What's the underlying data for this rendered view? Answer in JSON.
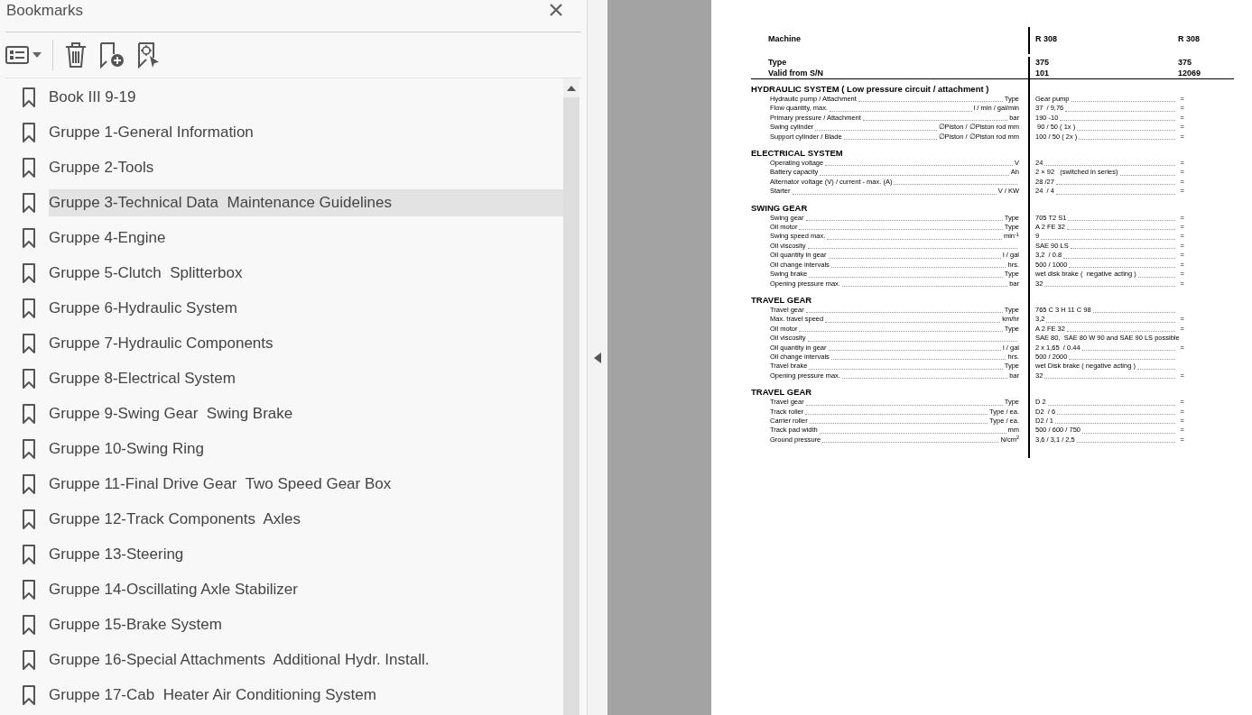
{
  "bookmarks": {
    "title": "Bookmarks",
    "items": [
      {
        "label": "Book III 9-19",
        "selected": false
      },
      {
        "label": "Gruppe 1-General Information",
        "selected": false
      },
      {
        "label": "Gruppe 2-Tools",
        "selected": false
      },
      {
        "label": "Gruppe 3-Technical Data  Maintenance Guidelines",
        "selected": true
      },
      {
        "label": "Gruppe 4-Engine",
        "selected": false
      },
      {
        "label": "Gruppe 5-Clutch  Splitterbox",
        "selected": false
      },
      {
        "label": "Gruppe 6-Hydraulic System",
        "selected": false
      },
      {
        "label": "Gruppe 7-Hydraulic Components",
        "selected": false
      },
      {
        "label": "Gruppe 8-Electrical System",
        "selected": false
      },
      {
        "label": "Gruppe 9-Swing Gear  Swing Brake",
        "selected": false
      },
      {
        "label": "Gruppe 10-Swing Ring",
        "selected": false
      },
      {
        "label": "Gruppe 11-Final Drive Gear  Two Speed Gear Box",
        "selected": false
      },
      {
        "label": "Gruppe 12-Track Components  Axles",
        "selected": false
      },
      {
        "label": "Gruppe 13-Steering",
        "selected": false
      },
      {
        "label": "Gruppe 14-Oscillating Axle Stabilizer",
        "selected": false
      },
      {
        "label": "Gruppe 15-Brake System",
        "selected": false
      },
      {
        "label": "Gruppe 16-Special Attachments  Additional Hydr. Install.",
        "selected": false
      },
      {
        "label": "Gruppe 17-Cab  Heater Air Conditioning System",
        "selected": false
      }
    ]
  },
  "document": {
    "header": [
      {
        "label": "Machine",
        "values": [
          "R 308",
          "R 308"
        ]
      },
      {
        "label": "Type",
        "values": [
          "375",
          "375"
        ]
      },
      {
        "label": "Valid from S/N",
        "values": [
          "101",
          "12069"
        ]
      }
    ],
    "sections": [
      {
        "title": "HYDRAULIC  SYSTEM ( Low pressure circuit / attachment )",
        "rows": [
          {
            "label": "Hydraulic pump / Attachment",
            "unit": "Type",
            "value": "Gear pump",
            "same": "="
          },
          {
            "label": "Flow quantity,  max.",
            "unit": "l / min / gal/min",
            "value": "37  / 9,76",
            "same": "="
          },
          {
            "label": "Primary pressure  / Attachment",
            "unit": "bar",
            "value": "190 -10",
            "same": "="
          },
          {
            "label": "Swing cylinder",
            "unit": "∅Piston / ∅Piston rod  mm",
            "value": " 90 / 50 ( 1x )",
            "same": "="
          },
          {
            "label": "Support cylinder / Blade",
            "unit": "∅Piston / ∅Piston rod  mm",
            "value": "100 / 50 ( 2x )",
            "same": "="
          }
        ]
      },
      {
        "title": "ELECTRICAL SYSTEM",
        "rows": [
          {
            "label": "Operating voltage",
            "unit": "V",
            "value": "24",
            "same": "="
          },
          {
            "label": "Battery capacity",
            "unit": "Ah",
            "value": "2 × 92   (switched in series)",
            "same": "="
          },
          {
            "label": "Alternator  voltage (V) / current - max. (A)",
            "value": "28 /27",
            "same": "="
          },
          {
            "label": "Starter",
            "unit": "V / KW",
            "value": "24  / 4",
            "same": "="
          }
        ]
      },
      {
        "title": "SWING GEAR",
        "rows": [
          {
            "label": "Swing gear",
            "unit": "Type",
            "value": "705 T2 S1",
            "same": "="
          },
          {
            "label": "Oil motor",
            "unit": "Type",
            "value": "A 2 FE 32",
            "same": "="
          },
          {
            "label": "Swing speed  max.",
            "unit": "min$^{-1}$",
            "value": "9",
            "same": "="
          },
          {
            "label": "Oil viscosity",
            "value": "SAE 90 LS",
            "same": "="
          },
          {
            "label": "Oil quantity in gear",
            "unit": "l / gal",
            "value": "3,2  / 0.8",
            "same": "="
          },
          {
            "label": "Oil change intervals",
            "unit": "hrs.",
            "value": "500 / 1000",
            "same": "="
          },
          {
            "label": "Swing brake",
            "unit": "Type",
            "value": "wet disk brake (  negative acting )",
            "same": "="
          },
          {
            "label": "Opening pressure max.",
            "unit": "bar",
            "value": "32",
            "same": "="
          }
        ]
      },
      {
        "title": "TRAVEL GEAR",
        "rows": [
          {
            "label": "Travel gear",
            "unit": "Type",
            "value": "765 C 3 H 11 C 98"
          },
          {
            "label": "Max. travel speed",
            "unit": "km/hr",
            "value": "3,2",
            "same": "="
          },
          {
            "label": "Oil motor",
            "unit": "Type",
            "value": "A 2 FE 32",
            "same": "="
          },
          {
            "label": "Oil viscosity",
            "value": "SAE 80,  SAE 80 W 90 and SAE 90 LS possible"
          },
          {
            "label": "Oil quantity in gear",
            "unit": "l / gal",
            "value": "2 x 1,65  / 0.44",
            "same": "="
          },
          {
            "label": "Oil change intervals",
            "unit": "hrs.",
            "value": "500 / 2000"
          },
          {
            "label": "Travel brake",
            "unit": "Type",
            "value": "wet Disk brake ( negative acting )"
          },
          {
            "label": "Opening pressure max.",
            "unit": "bar",
            "value": "32",
            "same": "="
          }
        ]
      },
      {
        "title": "TRAVEL GEAR",
        "rows": [
          {
            "label": "Travel gear",
            "unit": "Type",
            "value": "D 2",
            "same": "="
          },
          {
            "label": "Track roller",
            "unit": "Type / ea.",
            "value": "D2  / 6",
            "same": "="
          },
          {
            "label": "Carrier roller",
            "unit": "Type / ea.",
            "value": "D2 / 1",
            "same": "="
          },
          {
            "label": "Track pad width",
            "unit": "mm",
            "value": "500 / 600 / 750",
            "same": "="
          },
          {
            "label": "Ground pressure",
            "unit": "N/cm$^{2}$",
            "value": "3,6 / 3,1 / 2,5",
            "same": "="
          }
        ]
      }
    ]
  }
}
